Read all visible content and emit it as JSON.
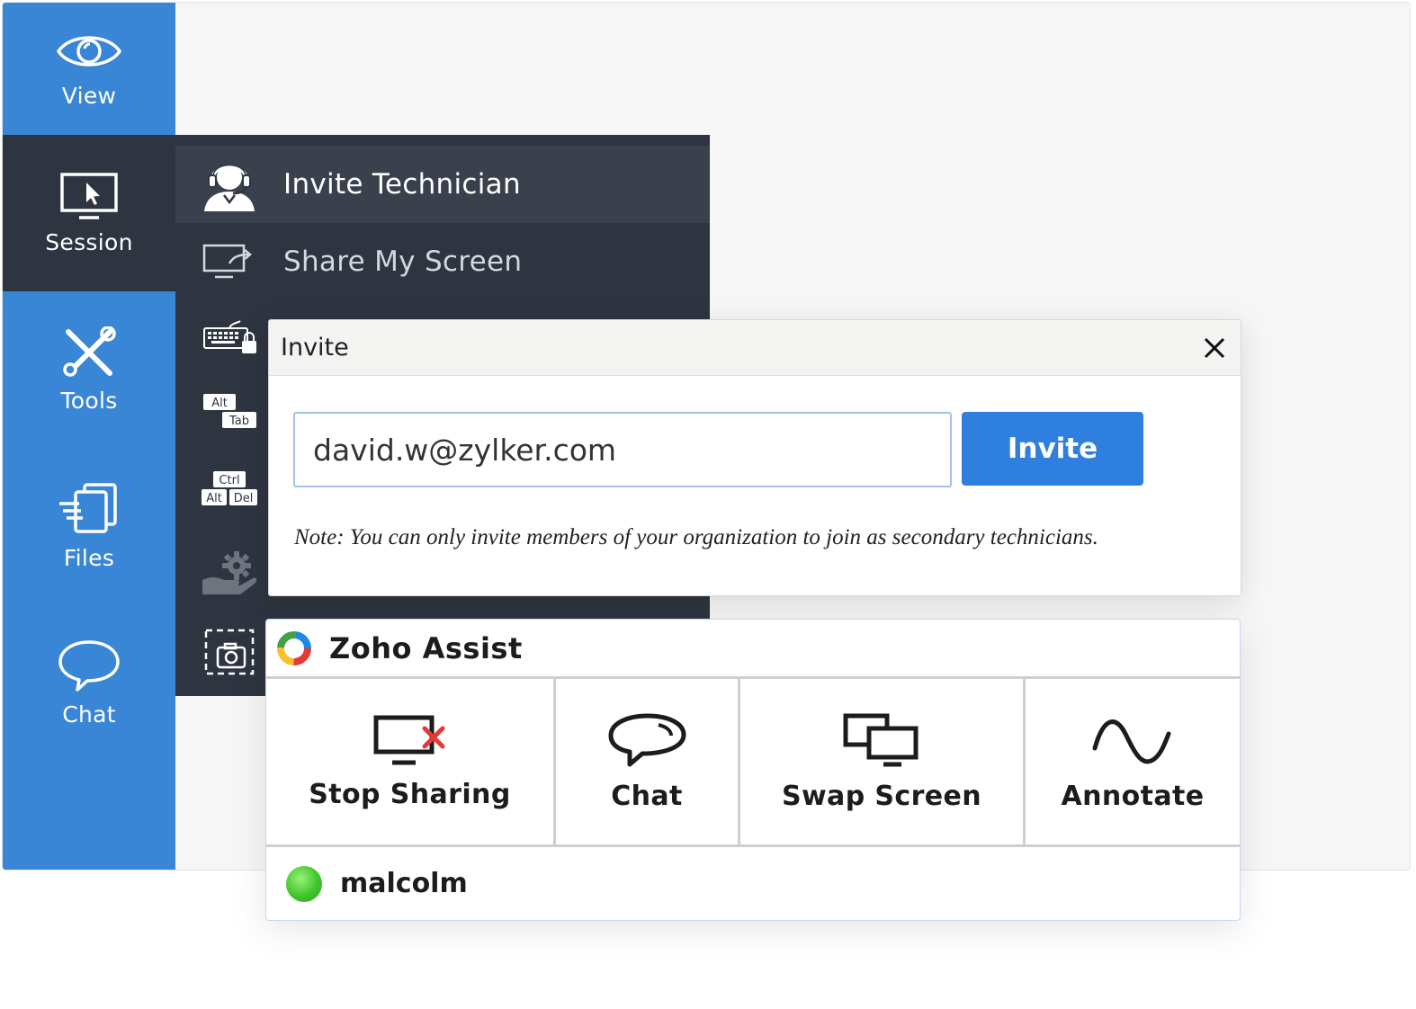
{
  "left_nav": {
    "items": [
      {
        "label": "View",
        "icon": "eye-icon"
      },
      {
        "label": "Session",
        "icon": "monitor-cursor-icon",
        "active": true
      },
      {
        "label": "Tools",
        "icon": "tools-icon"
      },
      {
        "label": "Files",
        "icon": "files-icon"
      },
      {
        "label": "Chat",
        "icon": "chat-bubble-icon"
      }
    ]
  },
  "session_menu": {
    "items": [
      {
        "label": "Invite Technician",
        "icon": "headset-technician-icon",
        "highlighted": true
      },
      {
        "label": "Share My Screen",
        "icon": "share-screen-icon"
      }
    ],
    "tool_icons": [
      {
        "icon": "keyboard-lock-icon"
      },
      {
        "icon": "alt-tab-icon",
        "keys": [
          "Alt",
          "Tab"
        ]
      },
      {
        "icon": "ctrl-alt-del-icon",
        "keys": [
          "Ctrl",
          "Alt",
          "Del"
        ]
      },
      {
        "icon": "hand-gear-icon"
      },
      {
        "icon": "screenshot-camera-icon"
      }
    ]
  },
  "invite_dialog": {
    "title": "Invite",
    "email_value": "david.w@zylker.com",
    "invite_button": "Invite",
    "note": "Note: You can only invite members of your organization to join as secondary technicians."
  },
  "assist_panel": {
    "title": "Zoho Assist",
    "actions": [
      {
        "label": "Stop Sharing",
        "icon": "stop-sharing-icon"
      },
      {
        "label": "Chat",
        "icon": "chat-bubble-icon"
      },
      {
        "label": "Swap Screen",
        "icon": "swap-screen-icon"
      },
      {
        "label": "Annotate",
        "icon": "annotate-wave-icon"
      }
    ],
    "user": {
      "name": "malcolm",
      "status": "online"
    }
  },
  "colors": {
    "nav_blue": "#3a86d6",
    "dark_panel": "#2f3540",
    "button_blue": "#2f80de",
    "status_green": "#3fc62b",
    "stop_red": "#e53935"
  }
}
